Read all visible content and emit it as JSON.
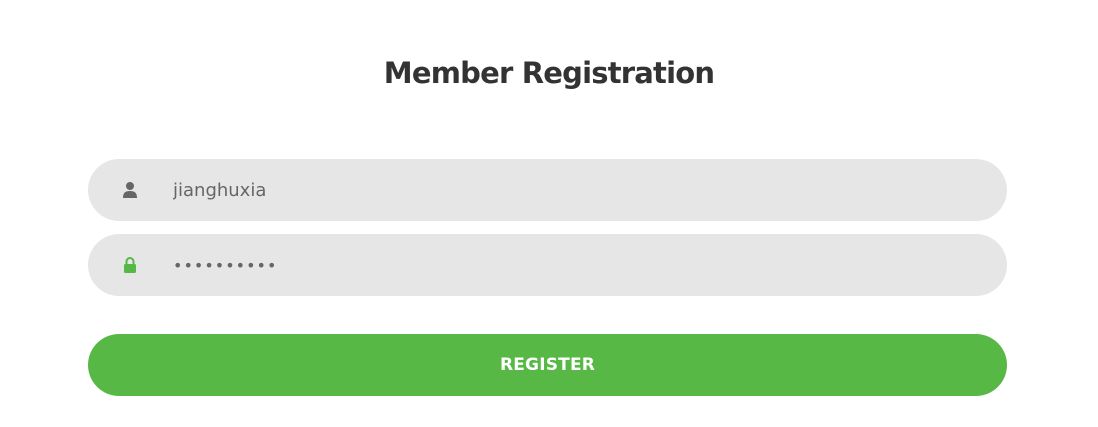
{
  "form": {
    "title": "Member Registration",
    "username": {
      "value": "jianghuxia",
      "icon": "user-icon"
    },
    "password": {
      "value": "jianghuxia",
      "icon": "lock-icon"
    },
    "register_label": "REGISTER"
  },
  "colors": {
    "accent": "#57b846",
    "field_background": "#e6e6e6",
    "title_text": "#333333",
    "input_text": "#666666",
    "user_icon": "#666666",
    "lock_icon": "#57b846"
  }
}
